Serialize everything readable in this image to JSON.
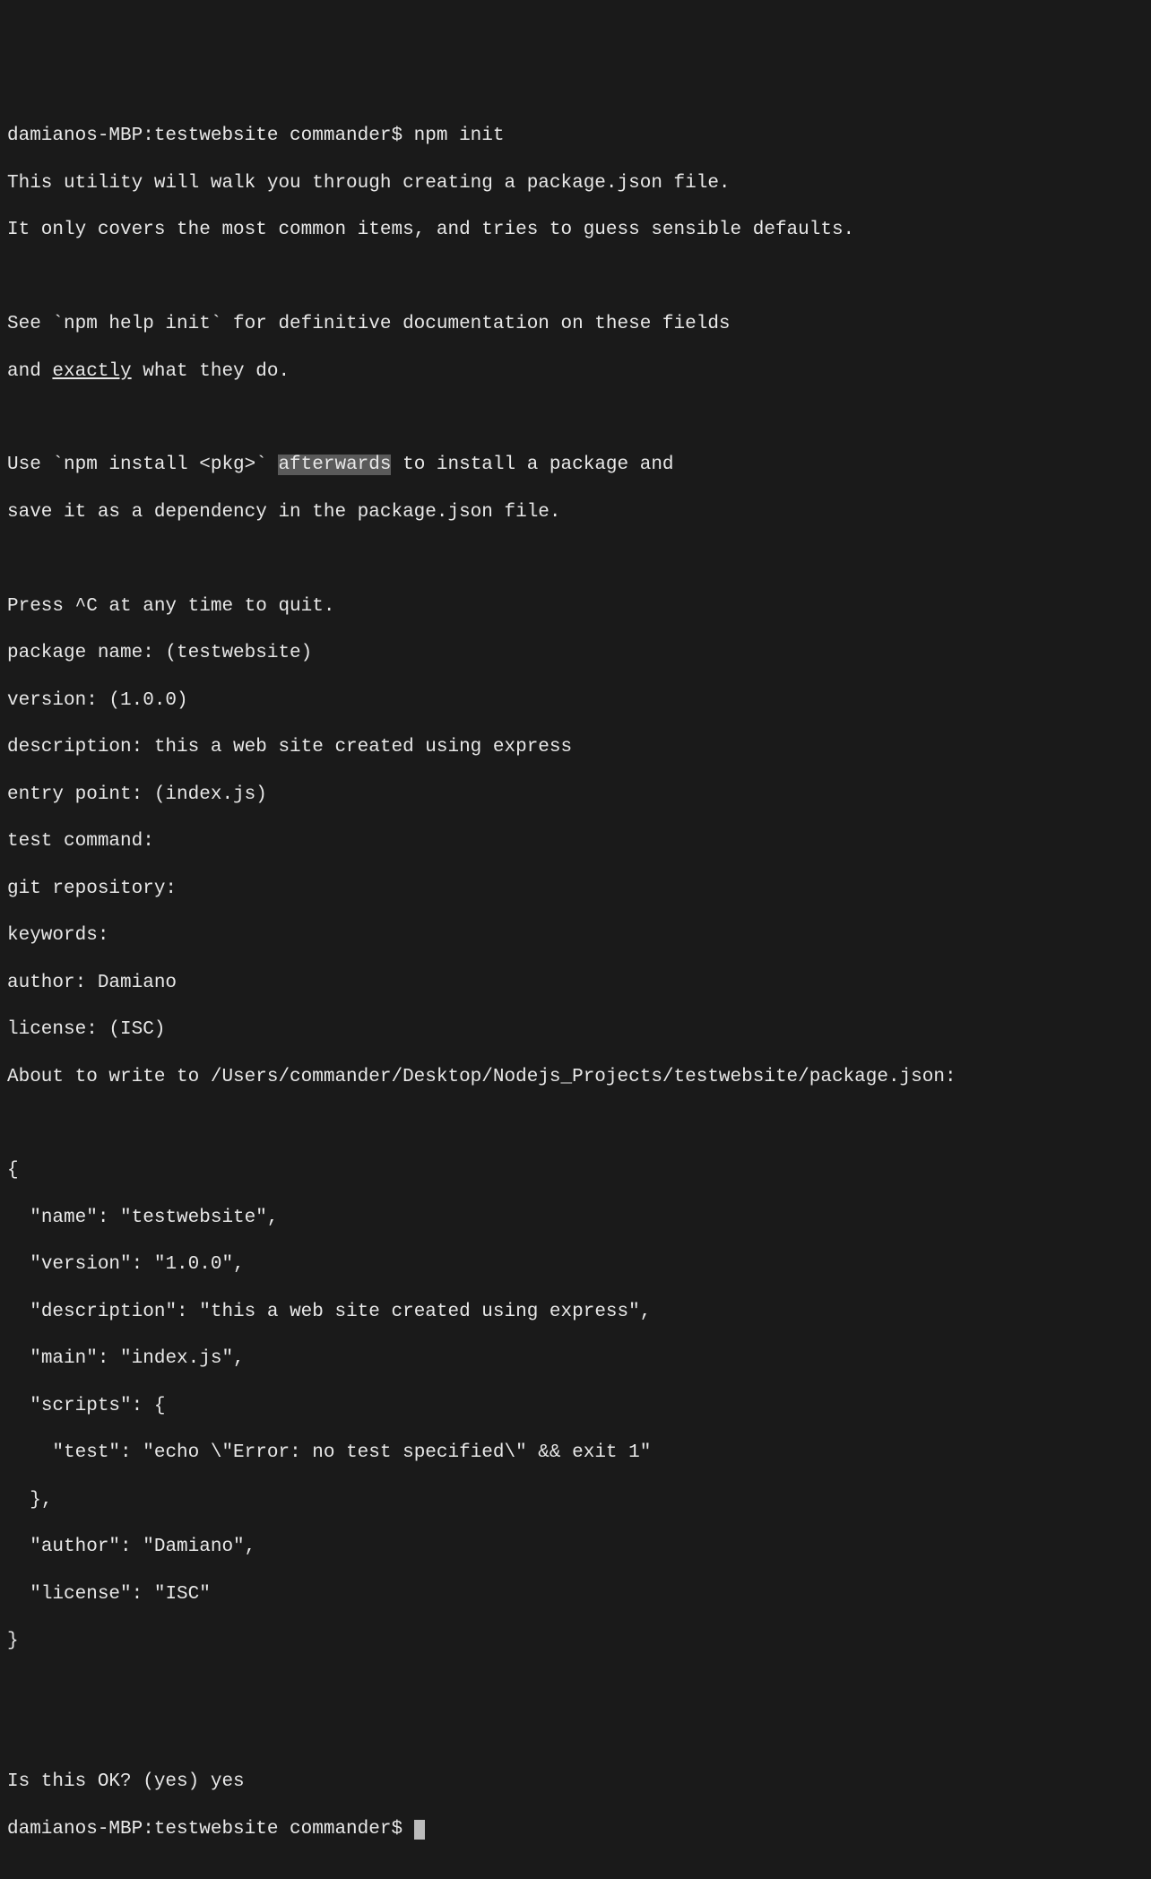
{
  "terminal": {
    "prompt1": "damianos-MBP:testwebsite commander$ npm init",
    "intro1": "This utility will walk you through creating a package.json file.",
    "intro2": "It only covers the most common items, and tries to guess sensible defaults.",
    "see1_pre": "See `npm help init` for definitive documentation on these fields",
    "see2_pre": "and ",
    "see2_underlined": "exactly",
    "see2_post": " what they do.",
    "use1_pre": "Use `npm install <pkg>` ",
    "use1_highlight": "afterwards",
    "use1_post": " to install a package and",
    "use2": "save it as a dependency in the package.json file.",
    "press": "Press ^C at any time to quit.",
    "q_package": "package name: (testwebsite) ",
    "q_version": "version: (1.0.0) ",
    "q_description": "description: this a web site created using express",
    "q_entry": "entry point: (index.js) ",
    "q_test": "test command: ",
    "q_git": "git repository: ",
    "q_keywords": "keywords: ",
    "q_author": "author: Damiano",
    "q_license": "license: (ISC) ",
    "about": "About to write to /Users/commander/Desktop/Nodejs_Projects/testwebsite/package.json:",
    "json_l1": "{",
    "json_l2": "  \"name\": \"testwebsite\",",
    "json_l3": "  \"version\": \"1.0.0\",",
    "json_l4": "  \"description\": \"this a web site created using express\",",
    "json_l5": "  \"main\": \"index.js\",",
    "json_l6": "  \"scripts\": {",
    "json_l7": "    \"test\": \"echo \\\"Error: no test specified\\\" && exit 1\"",
    "json_l8": "  },",
    "json_l9": "  \"author\": \"Damiano\",",
    "json_l10": "  \"license\": \"ISC\"",
    "json_l11": "}",
    "confirm": "Is this OK? (yes) yes",
    "prompt2": "damianos-MBP:testwebsite commander$ "
  }
}
